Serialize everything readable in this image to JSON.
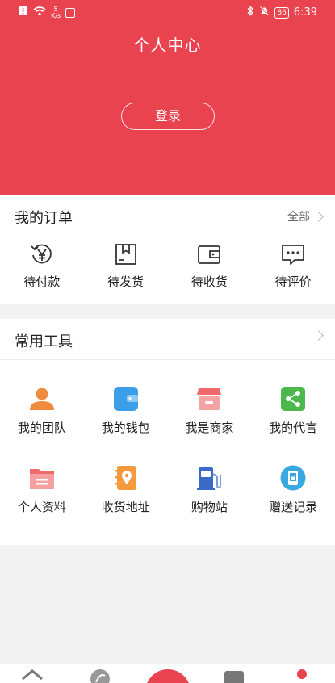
{
  "status_bar": {
    "speed_value": "5",
    "speed_unit": "K/s",
    "battery": "86",
    "time": "6:39",
    "icons": [
      "notification-icon",
      "wifi-icon",
      "message-icon",
      "bluetooth-icon",
      "mute-icon",
      "battery-icon"
    ]
  },
  "header": {
    "title": "个人中心",
    "login_label": "登录",
    "background_color": "#e8434f"
  },
  "orders": {
    "title": "我的订单",
    "more_label": "全部",
    "items": [
      {
        "label": "待付款",
        "icon": "yen-refresh-icon"
      },
      {
        "label": "待发货",
        "icon": "package-box-icon"
      },
      {
        "label": "待收货",
        "icon": "wallet-outline-icon"
      },
      {
        "label": "待评价",
        "icon": "comment-dots-icon"
      }
    ]
  },
  "tools": {
    "title": "常用工具",
    "items": [
      {
        "label": "我的团队",
        "icon": "team-icon",
        "color": "#f08a3c"
      },
      {
        "label": "我的钱包",
        "icon": "wallet-icon",
        "color": "#3b9ee8"
      },
      {
        "label": "我是商家",
        "icon": "store-icon",
        "color": "#ef6b6b"
      },
      {
        "label": "我的代言",
        "icon": "share-icon",
        "color": "#4cb84c"
      },
      {
        "label": "个人资料",
        "icon": "folder-icon",
        "color": "#ef6b6b"
      },
      {
        "label": "收货地址",
        "icon": "address-book-icon",
        "color": "#f29a3c"
      },
      {
        "label": "购物站",
        "icon": "gas-station-icon",
        "color": "#3c68c8"
      },
      {
        "label": "赠送记录",
        "icon": "gift-record-icon",
        "color": "#39a8e0"
      }
    ]
  },
  "bottom_nav": {
    "items": [
      "home-icon",
      "discover-icon",
      "center-action-icon",
      "category-icon",
      "profile-icon"
    ],
    "active_color": "#e8434f"
  }
}
